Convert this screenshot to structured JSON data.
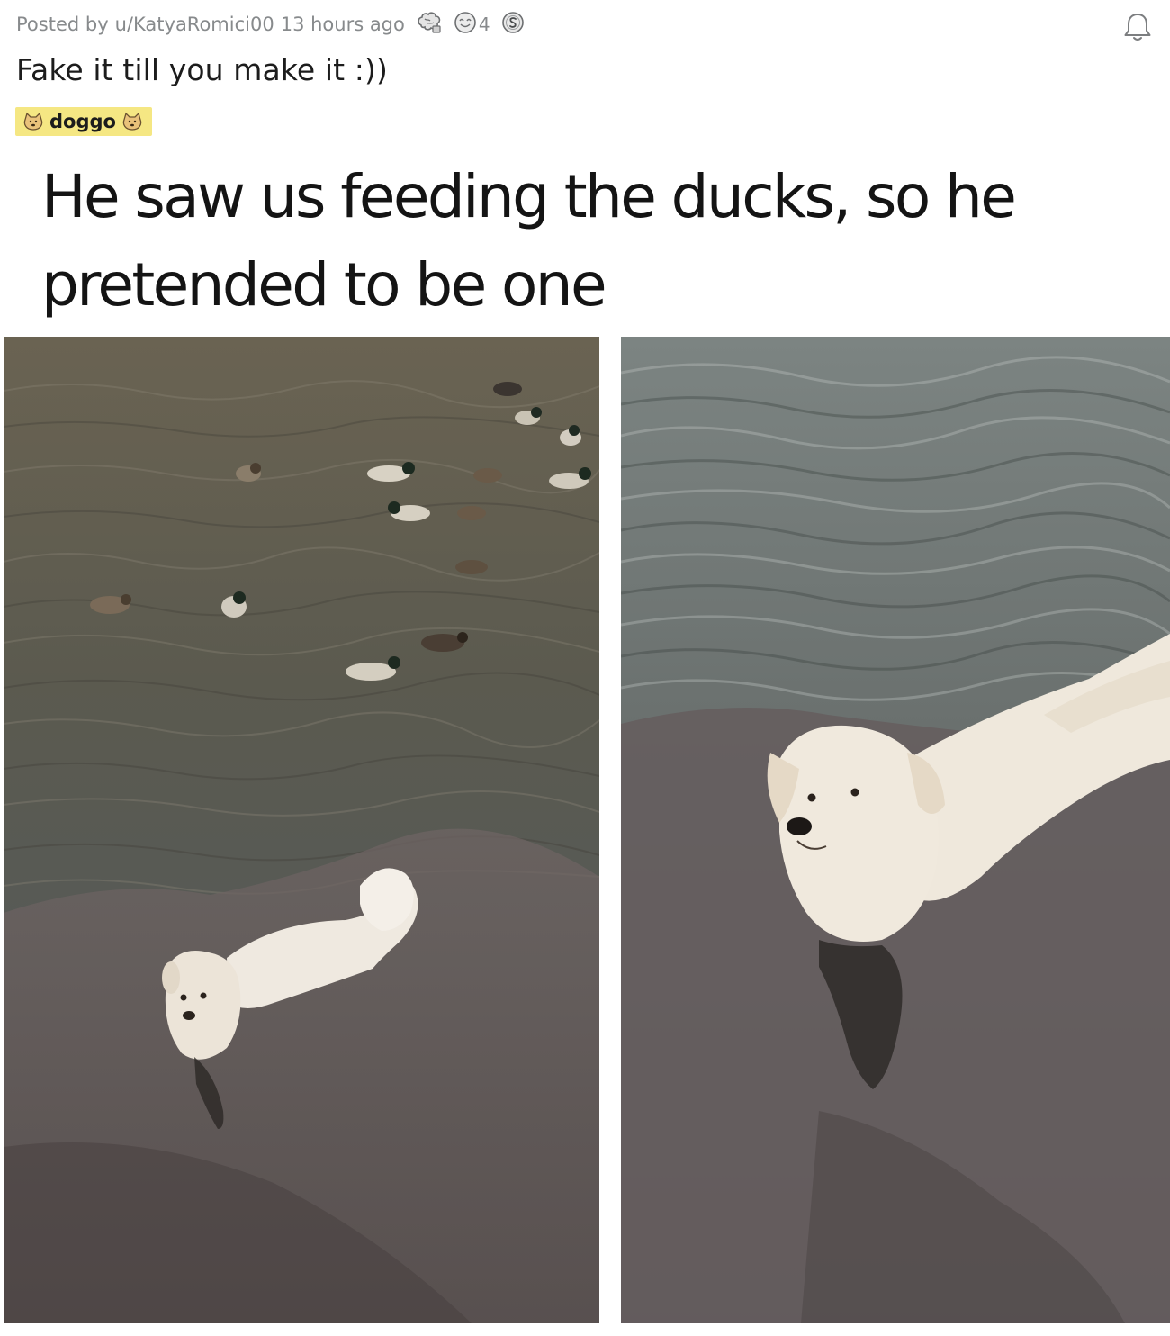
{
  "post": {
    "posted_by_prefix": "Posted by",
    "author": "u/KatyaRomici00",
    "age": "13 hours ago",
    "award_count": "4",
    "title": "Fake it till you make it :))",
    "flair": "doggo"
  },
  "media": {
    "caption": "He saw us feeding the ducks, so he pretended to be one"
  },
  "icons": {
    "award_1": "brain-award-icon",
    "award_2": "wholesome-award-icon",
    "award_3": "silver-coin-award-icon",
    "follow": "bell-icon",
    "flair_emoji": "doge-emoji-icon"
  },
  "colors": {
    "flair_background": "#f5e783",
    "meta_text": "#878a8c",
    "title_text": "#1c1c1c"
  }
}
